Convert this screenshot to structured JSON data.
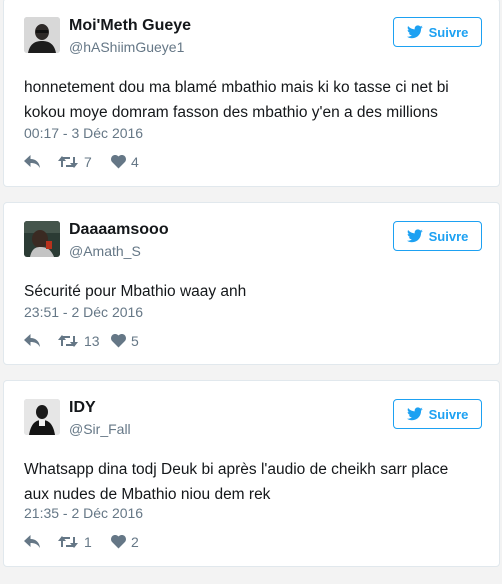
{
  "colors": {
    "accent": "#1da1f2",
    "name_text": "#14171a",
    "meta_text": "#657786",
    "page_bg": "#f3f3f3"
  },
  "follow_icon": "twitter-bird-icon",
  "tweets": [
    {
      "display_name": "Moi'Meth Gueye",
      "handle": "@hAShiimGueye1",
      "follow_label": "Suivre",
      "text_lines": [
        "honnetement dou ma blamé mbathio mais ki ko tasse ci net bi",
        "kokou moye domram fasson des mbathio y'en a des millions"
      ],
      "timestamp": "00:17 - 3 Déc 2016",
      "retweets": "7",
      "likes": "4"
    },
    {
      "display_name": "Daaaamsooo",
      "handle": "@Amath_S",
      "follow_label": "Suivre",
      "text_lines": [
        "Sécurité pour Mbathio waay anh"
      ],
      "timestamp": "23:51 - 2 Déc 2016",
      "retweets": "13",
      "likes": "5"
    },
    {
      "display_name": "IDY",
      "handle": "@Sir_Fall",
      "follow_label": "Suivre",
      "text_lines": [
        "Whatsapp dina todj Deuk bi après l'audio de cheikh sarr place",
        "aux nudes de Mbathio niou dem rek"
      ],
      "timestamp": "21:35 - 2 Déc 2016",
      "retweets": "1",
      "likes": "2"
    }
  ]
}
